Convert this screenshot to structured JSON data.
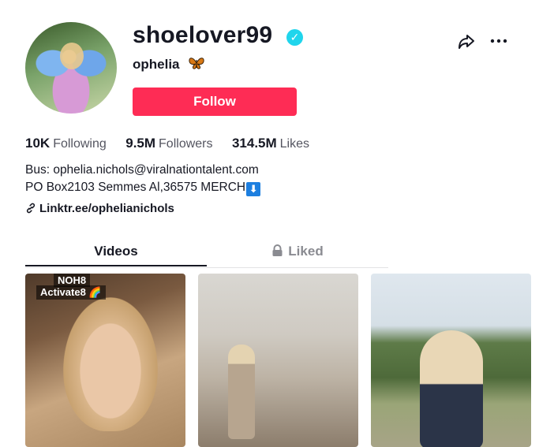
{
  "profile": {
    "username": "shoelover99",
    "nickname": "ophelia",
    "nickname_emoji": "🦋",
    "follow_label": "Follow"
  },
  "stats": [
    {
      "value": "10K",
      "label": "Following"
    },
    {
      "value": "9.5M",
      "label": "Followers"
    },
    {
      "value": "314.5M",
      "label": "Likes"
    }
  ],
  "bio": {
    "line1": "Bus: ophelia.nichols@viralnationtalent.com",
    "line2": "PO Box2103 Semmes Al,36575 MERCH",
    "line2_icon": "⬇"
  },
  "link": {
    "text": "Linktr.ee/ophelianichols"
  },
  "tabs": {
    "videos": "Videos",
    "liked": "Liked"
  },
  "thumbnails": [
    {
      "overlay_lines": [
        "NOH8",
        "Activate8 🌈"
      ]
    },
    {
      "overlay_lines": []
    },
    {
      "overlay_lines": []
    }
  ],
  "colors": {
    "accent": "#fe2c55",
    "verified": "#20d5ec",
    "link_icon": "link-icon",
    "muted": "#8a8b91"
  }
}
